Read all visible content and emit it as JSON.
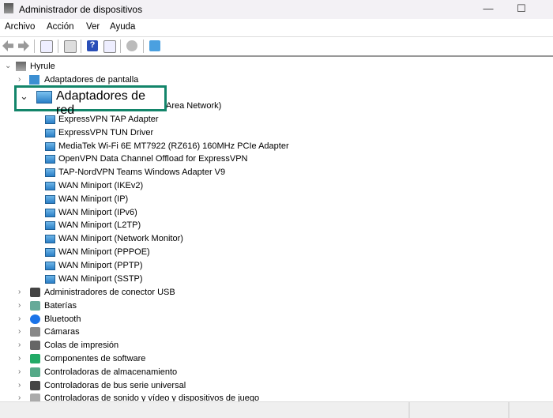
{
  "window": {
    "title": "Administrador de dispositivos",
    "minimize": "—",
    "maximize": "☐"
  },
  "menu": [
    "Archivo",
    "Acción",
    "Ver",
    "Ayuda"
  ],
  "toolbar": [
    "back-icon",
    "forward-icon",
    "show-hide-tree-icon",
    "properties-icon",
    "help-icon",
    "run-icon",
    "update-driver-icon",
    "scan-hardware-icon"
  ],
  "tree": {
    "root": "Hyrule",
    "display": "Adaptadores de pantalla",
    "network": {
      "label": "Adaptadores de red",
      "first_child_partial": "Area Network)",
      "children": [
        "ExpressVPN TAP Adapter",
        "ExpressVPN TUN Driver",
        "MediaTek Wi-Fi 6E MT7922 (RZ616) 160MHz PCIe Adapter",
        "OpenVPN Data Channel Offload for ExpressVPN",
        "TAP-NordVPN Teams Windows Adapter V9",
        "WAN Miniport (IKEv2)",
        "WAN Miniport (IP)",
        "WAN Miniport (IPv6)",
        "WAN Miniport (L2TP)",
        "WAN Miniport (Network Monitor)",
        "WAN Miniport (PPPOE)",
        "WAN Miniport (PPTP)",
        "WAN Miniport (SSTP)"
      ]
    },
    "categories": [
      "Administradores de conector USB",
      "Baterías",
      "Bluetooth",
      "Cámaras",
      "Colas de impresión",
      "Componentes de software",
      "Controladoras de almacenamiento",
      "Controladoras de bus serie universal",
      "Controladoras de sonido y vídeo y dispositivos de juego"
    ]
  },
  "highlight_color": "#13856a"
}
